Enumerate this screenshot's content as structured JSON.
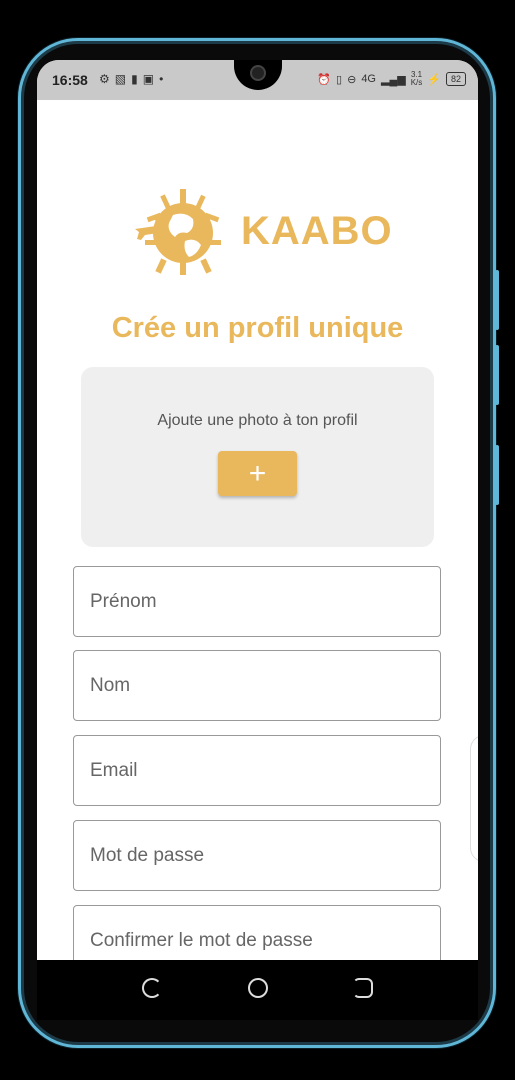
{
  "status_bar": {
    "time": "16:58",
    "left_icons": [
      "gear-icon",
      "image-icon",
      "sim-icon",
      "p-icon",
      "dot-icon"
    ],
    "right_icons": [
      "alarm-icon",
      "vibrate-icon",
      "dnd-icon",
      "signal-icon"
    ],
    "net_speed_value": "3.1",
    "net_speed_unit": "K/s",
    "network_type": "4G",
    "battery_level": "82"
  },
  "brand": {
    "name": "KAABO",
    "color": "#eab85c"
  },
  "page": {
    "title": "Crée un profil unique"
  },
  "photo": {
    "label": "Ajoute une photo à ton profil",
    "add_button": "+"
  },
  "form": {
    "fields": [
      {
        "placeholder": "Prénom",
        "value": ""
      },
      {
        "placeholder": "Nom",
        "value": ""
      },
      {
        "placeholder": "Email",
        "value": ""
      },
      {
        "placeholder": "Mot de passe",
        "value": ""
      },
      {
        "placeholder": "Confirmer le mot de passe",
        "value": ""
      }
    ]
  },
  "nav_bar": {
    "icons": [
      "back-icon",
      "home-icon",
      "recent-apps-icon"
    ]
  }
}
